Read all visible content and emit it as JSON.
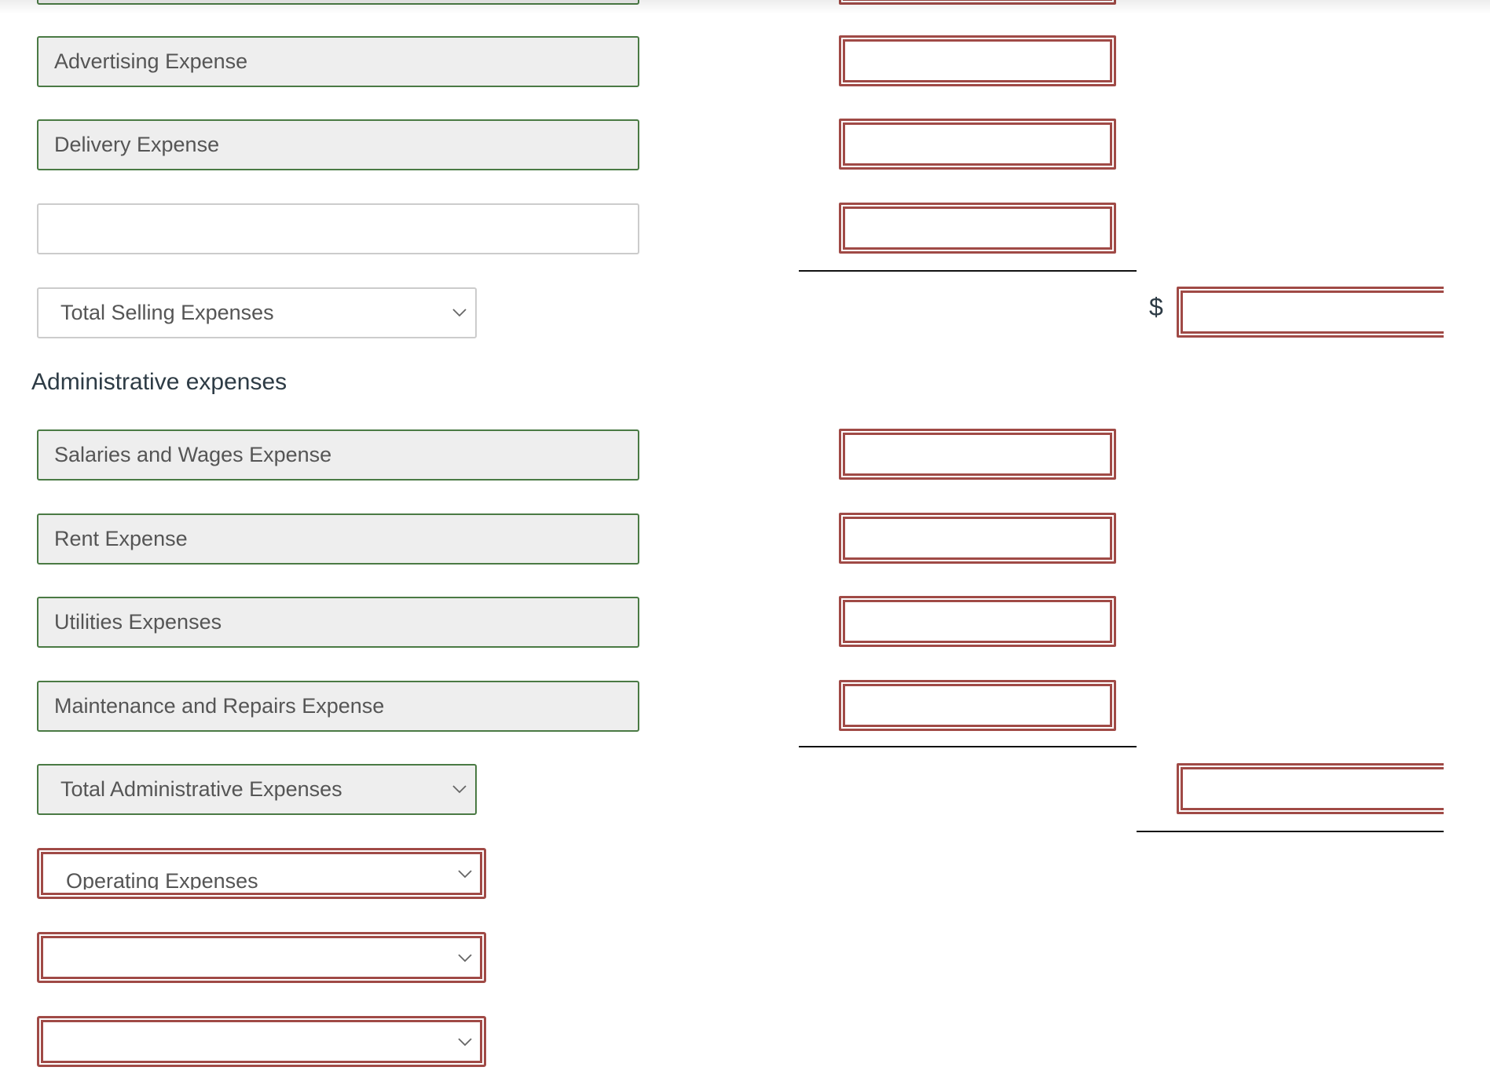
{
  "colors": {
    "correct_border": "#4a7a44",
    "incorrect_border": "#a04a46",
    "readonly_fill": "#eeeeee",
    "text": "#555555",
    "heading_text": "#2d3b45"
  },
  "selling_section": {
    "rows": [
      {
        "account": "Advertising Expense",
        "amount": ""
      },
      {
        "account": "Delivery Expense",
        "amount": ""
      },
      {
        "account": "",
        "amount": ""
      }
    ],
    "total_select": {
      "selected": "Total Selling Expenses"
    },
    "total_currency": "$",
    "total_amount": ""
  },
  "administrative_section": {
    "heading": "Administrative expenses",
    "rows": [
      {
        "account": "Salaries and Wages Expense",
        "amount": ""
      },
      {
        "account": "Rent Expense",
        "amount": ""
      },
      {
        "account": "Utilities Expenses",
        "amount": ""
      },
      {
        "account": "Maintenance and Repairs Expense",
        "amount": ""
      }
    ],
    "total_select": {
      "selected": "Total Administrative Expenses"
    },
    "total_amount": ""
  },
  "bottom_selects": [
    {
      "selected": "Operating Expenses"
    },
    {
      "selected": ""
    },
    {
      "selected": ""
    }
  ],
  "icons": {
    "select_chevron": "chevron-down-icon"
  }
}
